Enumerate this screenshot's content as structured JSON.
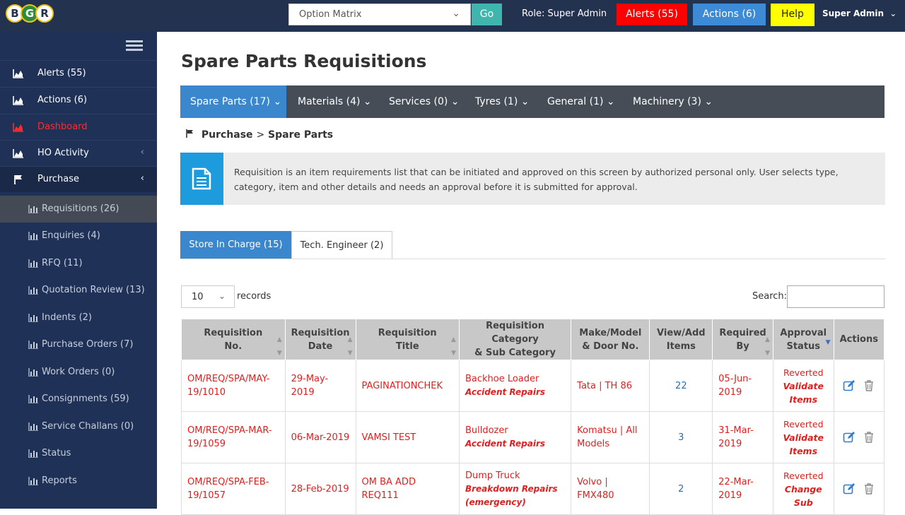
{
  "brand": {
    "letters": [
      "B",
      "G",
      "R"
    ]
  },
  "header": {
    "matrix_select": "Option Matrix",
    "go_label": "Go",
    "role_text": "Role: Super Admin",
    "alerts_label": "Alerts (55)",
    "actions_label": "Actions (6)",
    "help_label": "Help",
    "user_label": "Super Admin"
  },
  "sidebar": {
    "items": [
      {
        "label": "Alerts (55)",
        "icon": "area-chart-icon"
      },
      {
        "label": "Actions (6)",
        "icon": "area-chart-icon"
      },
      {
        "label": "Dashboard",
        "icon": "area-chart-icon"
      },
      {
        "label": "HO Activity",
        "icon": "area-chart-icon"
      },
      {
        "label": "Purchase",
        "icon": "flag-icon"
      }
    ],
    "sub_items": [
      {
        "label": "Requisitions (26)"
      },
      {
        "label": "Enquiries (4)"
      },
      {
        "label": "RFQ (11)"
      },
      {
        "label": "Quotation Review (13)"
      },
      {
        "label": "Indents (2)"
      },
      {
        "label": "Purchase Orders (7)"
      },
      {
        "label": "Work Orders (0)"
      },
      {
        "label": "Consignments (59)"
      },
      {
        "label": "Service Challans (0)"
      },
      {
        "label": "Status"
      },
      {
        "label": "Reports"
      }
    ]
  },
  "page": {
    "title": "Spare Parts Requisitions",
    "tabs": [
      {
        "label": "Spare Parts (17)"
      },
      {
        "label": "Materials (4)"
      },
      {
        "label": "Services (0)"
      },
      {
        "label": "Tyres (1)"
      },
      {
        "label": "General (1)"
      },
      {
        "label": "Machinery (3)"
      }
    ],
    "breadcrumb": {
      "parent": "Purchase",
      "sep": ">",
      "current": "Spare Parts"
    },
    "info": "Requisition is an item requirements list that can be initiated and approved on this screen by authorized personal only. User selects type, category, item and other details and needs an approval before it is submitted for approval.",
    "subtabs": [
      {
        "label": "Store In Charge (15)"
      },
      {
        "label": "Tech. Engineer (2)"
      }
    ],
    "length_value": "10",
    "records_label": "records",
    "search_label": "Search:"
  },
  "table": {
    "headers": {
      "no": [
        "Requisition",
        "No."
      ],
      "date": [
        "Requisition",
        "Date"
      ],
      "title": [
        "Requisition",
        "Title"
      ],
      "category": [
        "Requisition Category",
        "& Sub Category"
      ],
      "make": [
        "Make/Model",
        "& Door No."
      ],
      "items": [
        "View/Add",
        "Items"
      ],
      "by": [
        "Required",
        "By"
      ],
      "status": [
        "Approval",
        "Status"
      ],
      "actions": "Actions"
    },
    "rows": [
      {
        "no": [
          "OM/REQ/SPA/MAY-",
          "19/1010"
        ],
        "date": [
          "29-May-",
          "2019"
        ],
        "title": "PAGINATIONCHEK",
        "cat": "Backhoe Loader",
        "sub": "Accident Repairs",
        "make": [
          "Tata | TH 86"
        ],
        "items": "22",
        "by": [
          "05-Jun-",
          "2019"
        ],
        "status": "Reverted",
        "status2": [
          "Validate",
          "Items"
        ]
      },
      {
        "no": [
          "OM/REQ/SPA-MAR-",
          "19/1059"
        ],
        "date": [
          "06-Mar-2019"
        ],
        "title": "VAMSI TEST",
        "cat": "Bulldozer",
        "sub": "Accident Repairs",
        "make": [
          "Komatsu | All",
          "Models"
        ],
        "items": "3",
        "by": [
          "31-Mar-",
          "2019"
        ],
        "status": "Reverted",
        "status2": [
          "Validate",
          "Items"
        ]
      },
      {
        "no": [
          "OM/REQ/SPA-FEB-",
          "19/1057"
        ],
        "date": [
          "28-Feb-2019"
        ],
        "title": "OM BA ADD REQ111",
        "cat": "Dump Truck",
        "sub": "Breakdown Repairs",
        "sub2": "(emergency)",
        "make": [
          "Volvo |",
          "FMX480"
        ],
        "items": "2",
        "by": [
          "22-Mar-",
          "2019"
        ],
        "status": "Reverted",
        "status2": [
          "Change",
          "Sub"
        ]
      }
    ]
  },
  "colors": {
    "topbar": "#23324f",
    "sidebar": "#1f3157",
    "accent": "#3a87cd",
    "alerts": "#ff0000",
    "help": "#ffff00",
    "link_red": "#e02020"
  }
}
